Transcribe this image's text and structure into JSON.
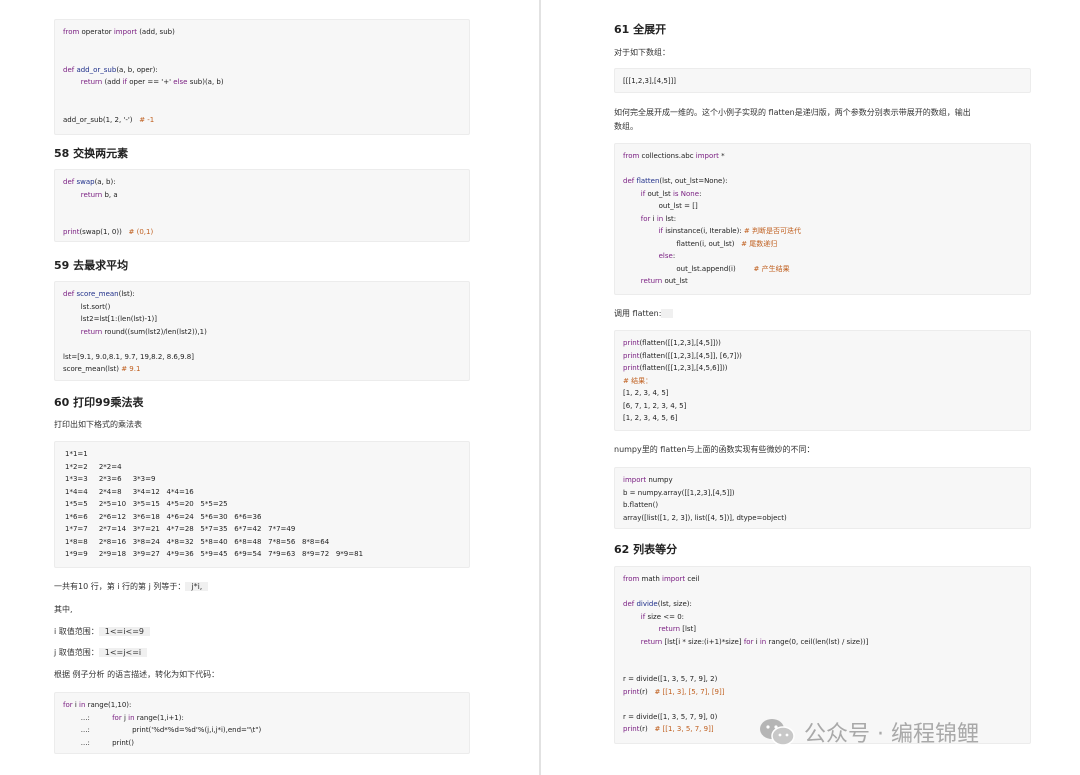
{
  "left": {
    "block1": [
      [
        {
          "t": "from ",
          "c": "kw"
        },
        {
          "t": "operator "
        },
        {
          "t": "import ",
          "c": "kw"
        },
        {
          "t": "(add, sub)"
        }
      ],
      [],
      [],
      [
        {
          "t": "def ",
          "c": "kw"
        },
        {
          "t": "add_or_sub",
          "c": "fn"
        },
        {
          "t": "(a, b, oper):"
        }
      ],
      [
        {
          "t": "        return ",
          "c": "kw"
        },
        {
          "t": "(add "
        },
        {
          "t": "if ",
          "c": "kw"
        },
        {
          "t": "oper == '+' "
        },
        {
          "t": "else ",
          "c": "kw"
        },
        {
          "t": "sub)(a, b)"
        }
      ],
      [],
      [],
      [
        {
          "t": "add_or_sub(1, 2, '-')   "
        },
        {
          "t": "# -1",
          "c": "cm"
        }
      ]
    ],
    "h58": "58 交换两元素",
    "block2": [
      [
        {
          "t": "def ",
          "c": "kw"
        },
        {
          "t": "swap",
          "c": "fn"
        },
        {
          "t": "(a, b):"
        }
      ],
      [
        {
          "t": "        return ",
          "c": "kw"
        },
        {
          "t": "b, a"
        }
      ],
      [],
      [],
      [
        {
          "t": "print",
          "c": "kw"
        },
        {
          "t": "(swap(1, 0))   "
        },
        {
          "t": "# (0,1)",
          "c": "cm"
        }
      ]
    ],
    "h59": "59 去最求平均",
    "block3": [
      [
        {
          "t": "def ",
          "c": "kw"
        },
        {
          "t": "score_mean",
          "c": "fn"
        },
        {
          "t": "(lst):"
        }
      ],
      [
        {
          "t": "        lst.sort()"
        }
      ],
      [
        {
          "t": "        lst2=lst[1:(len(lst)-1)]"
        }
      ],
      [
        {
          "t": "        return ",
          "c": "kw"
        },
        {
          "t": "round((sum(lst2)/len(lst2)),1)"
        }
      ],
      [],
      [
        {
          "t": "lst=[9.1, 9.0,8.1, 9.7, 19,8.2, 8.6,9.8]"
        }
      ],
      [
        {
          "t": "score_mean(lst) "
        },
        {
          "t": "# 9.1",
          "c": "cm"
        }
      ]
    ],
    "h60": "60 打印99乘法表",
    "p60": "打印出如下格式的乘法表",
    "table99": [
      "1*1=1",
      "1*2=2     2*2=4",
      "1*3=3     2*3=6     3*3=9",
      "1*4=4     2*4=8     3*4=12   4*4=16",
      "1*5=5     2*5=10   3*5=15   4*5=20   5*5=25",
      "1*6=6     2*6=12   3*6=18   4*6=24   5*6=30   6*6=36",
      "1*7=7     2*7=14   3*7=21   4*7=28   5*7=35   6*7=42   7*7=49",
      "1*8=8     2*8=16   3*8=24   4*8=32   5*8=40   6*8=48   7*8=56   8*8=64",
      "1*9=9     2*9=18   3*9=27   4*9=36   5*9=45   6*9=54   7*9=63   8*9=72   9*9=81"
    ],
    "p_rows": "一共有10 行，第 i 行的第 j 列等于：",
    "p_rows_code": "j*i,",
    "p_where": "其中,",
    "p_i_label": "i 取值范围：",
    "p_i_code": "1<=i<=9",
    "p_j_label": "j 取值范围：",
    "p_j_code": "1<=j<=i",
    "p_convert": "根据 例子分析 的语言描述，转化为如下代码：",
    "block4": [
      [
        {
          "t": "for ",
          "c": "kw"
        },
        {
          "t": "i "
        },
        {
          "t": "in ",
          "c": "kw"
        },
        {
          "t": "range(1,10):"
        }
      ],
      [
        {
          "t": "        ...:          "
        },
        {
          "t": "for ",
          "c": "kw"
        },
        {
          "t": "j "
        },
        {
          "t": "in ",
          "c": "kw"
        },
        {
          "t": "range(1,i+1):"
        }
      ],
      [
        {
          "t": "        ...:                   print('%d*%d=%d'%(j,i,j*i),end=\"\\t\")"
        }
      ],
      [
        {
          "t": "        ...:          print()"
        }
      ]
    ]
  },
  "right": {
    "h61": "61 全展开",
    "p61": "对于如下数组：",
    "block_arr": [
      [
        {
          "t": "[[[1,2,3],[4,5]]]"
        }
      ]
    ],
    "p61b_line1": "如何完全展开成一维的。这个小例子实现的 flatten是递归版，两个参数分别表示带展开的数组，输出",
    "p61b_line2": "数组。",
    "block_flat": [
      [
        {
          "t": "from ",
          "c": "kw"
        },
        {
          "t": "collections.abc "
        },
        {
          "t": "import ",
          "c": "kw"
        },
        {
          "t": "*"
        }
      ],
      [],
      [
        {
          "t": "def ",
          "c": "kw"
        },
        {
          "t": "flatten",
          "c": "fn"
        },
        {
          "t": "(lst, out_lst=None):"
        }
      ],
      [
        {
          "t": "        if ",
          "c": "kw"
        },
        {
          "t": "out_lst "
        },
        {
          "t": "is None",
          "c": "kw"
        },
        {
          "t": ":"
        }
      ],
      [
        {
          "t": "                out_lst = []"
        }
      ],
      [
        {
          "t": "        for ",
          "c": "kw"
        },
        {
          "t": "i "
        },
        {
          "t": "in ",
          "c": "kw"
        },
        {
          "t": "lst:"
        }
      ],
      [
        {
          "t": "                if ",
          "c": "kw"
        },
        {
          "t": "isinstance(i, Iterable): "
        },
        {
          "t": "# 判断是否可迭代",
          "c": "cm"
        }
      ],
      [
        {
          "t": "                        flatten(i, out_lst)   "
        },
        {
          "t": "# 尾数递归",
          "c": "cm"
        }
      ],
      [
        {
          "t": "                else",
          "c": "kw"
        },
        {
          "t": ":"
        }
      ],
      [
        {
          "t": "                        out_lst.append(i)        "
        },
        {
          "t": "# 产生结果",
          "c": "cm"
        }
      ],
      [
        {
          "t": "        return ",
          "c": "kw"
        },
        {
          "t": "out_lst"
        }
      ]
    ],
    "p_call": "调用 flatten:",
    "block_call": [
      [
        {
          "t": "print",
          "c": "kw"
        },
        {
          "t": "(flatten([[1,2,3],[4,5]]))"
        }
      ],
      [
        {
          "t": "print",
          "c": "kw"
        },
        {
          "t": "(flatten([[1,2,3],[4,5]], [6,7]))"
        }
      ],
      [
        {
          "t": "print",
          "c": "kw"
        },
        {
          "t": "(flatten([[1,2,3],[4,5,6]]))"
        }
      ],
      [
        {
          "t": "# 结果：",
          "c": "cm"
        }
      ],
      [
        {
          "t": "[1, 2, 3, 4, 5]"
        }
      ],
      [
        {
          "t": "[6, 7, 1, 2, 3, 4, 5]"
        }
      ],
      [
        {
          "t": "[1, 2, 3, 4, 5, 6]"
        }
      ]
    ],
    "p_numpy": "numpy里的 flatten与上面的函数实现有些微妙的不同：",
    "block_numpy": [
      [
        {
          "t": "import ",
          "c": "kw"
        },
        {
          "t": "numpy"
        }
      ],
      [
        {
          "t": "b = numpy.array([[1,2,3],[4,5]])"
        }
      ],
      [
        {
          "t": "b.flatten()"
        }
      ],
      [
        {
          "t": "array([list([1, 2, 3]), list([4, 5])], dtype=object)"
        }
      ]
    ],
    "h62": "62 列表等分",
    "block_divide": [
      [
        {
          "t": "from ",
          "c": "kw"
        },
        {
          "t": "math "
        },
        {
          "t": "import ",
          "c": "kw"
        },
        {
          "t": "ceil"
        }
      ],
      [],
      [
        {
          "t": "def ",
          "c": "kw"
        },
        {
          "t": "divide",
          "c": "fn"
        },
        {
          "t": "(lst, size):"
        }
      ],
      [
        {
          "t": "        if ",
          "c": "kw"
        },
        {
          "t": "size <= 0:"
        }
      ],
      [
        {
          "t": "                return ",
          "c": "kw"
        },
        {
          "t": "[lst]"
        }
      ],
      [
        {
          "t": "        return ",
          "c": "kw"
        },
        {
          "t": "[lst[i * size:(i+1)*size] "
        },
        {
          "t": "for ",
          "c": "kw"
        },
        {
          "t": "i "
        },
        {
          "t": "in ",
          "c": "kw"
        },
        {
          "t": "range(0, ceil(len(lst) / size))]"
        }
      ],
      [],
      [],
      [
        {
          "t": "r = divide([1, 3, 5, 7, 9], 2)"
        }
      ],
      [
        {
          "t": "print",
          "c": "kw"
        },
        {
          "t": "(r)   "
        },
        {
          "t": "# [[1, 3], [5, 7], [9]]",
          "c": "cm"
        }
      ],
      [],
      [
        {
          "t": "r = divide([1, 3, 5, 7, 9], 0)"
        }
      ],
      [
        {
          "t": "print",
          "c": "kw"
        },
        {
          "t": "(r)   "
        },
        {
          "t": "# [[1, 3, 5, 7, 9]]",
          "c": "cm"
        }
      ]
    ]
  },
  "watermark": {
    "text": "公众号 · 编程锦鲤",
    "icon": "wechat-icon"
  }
}
